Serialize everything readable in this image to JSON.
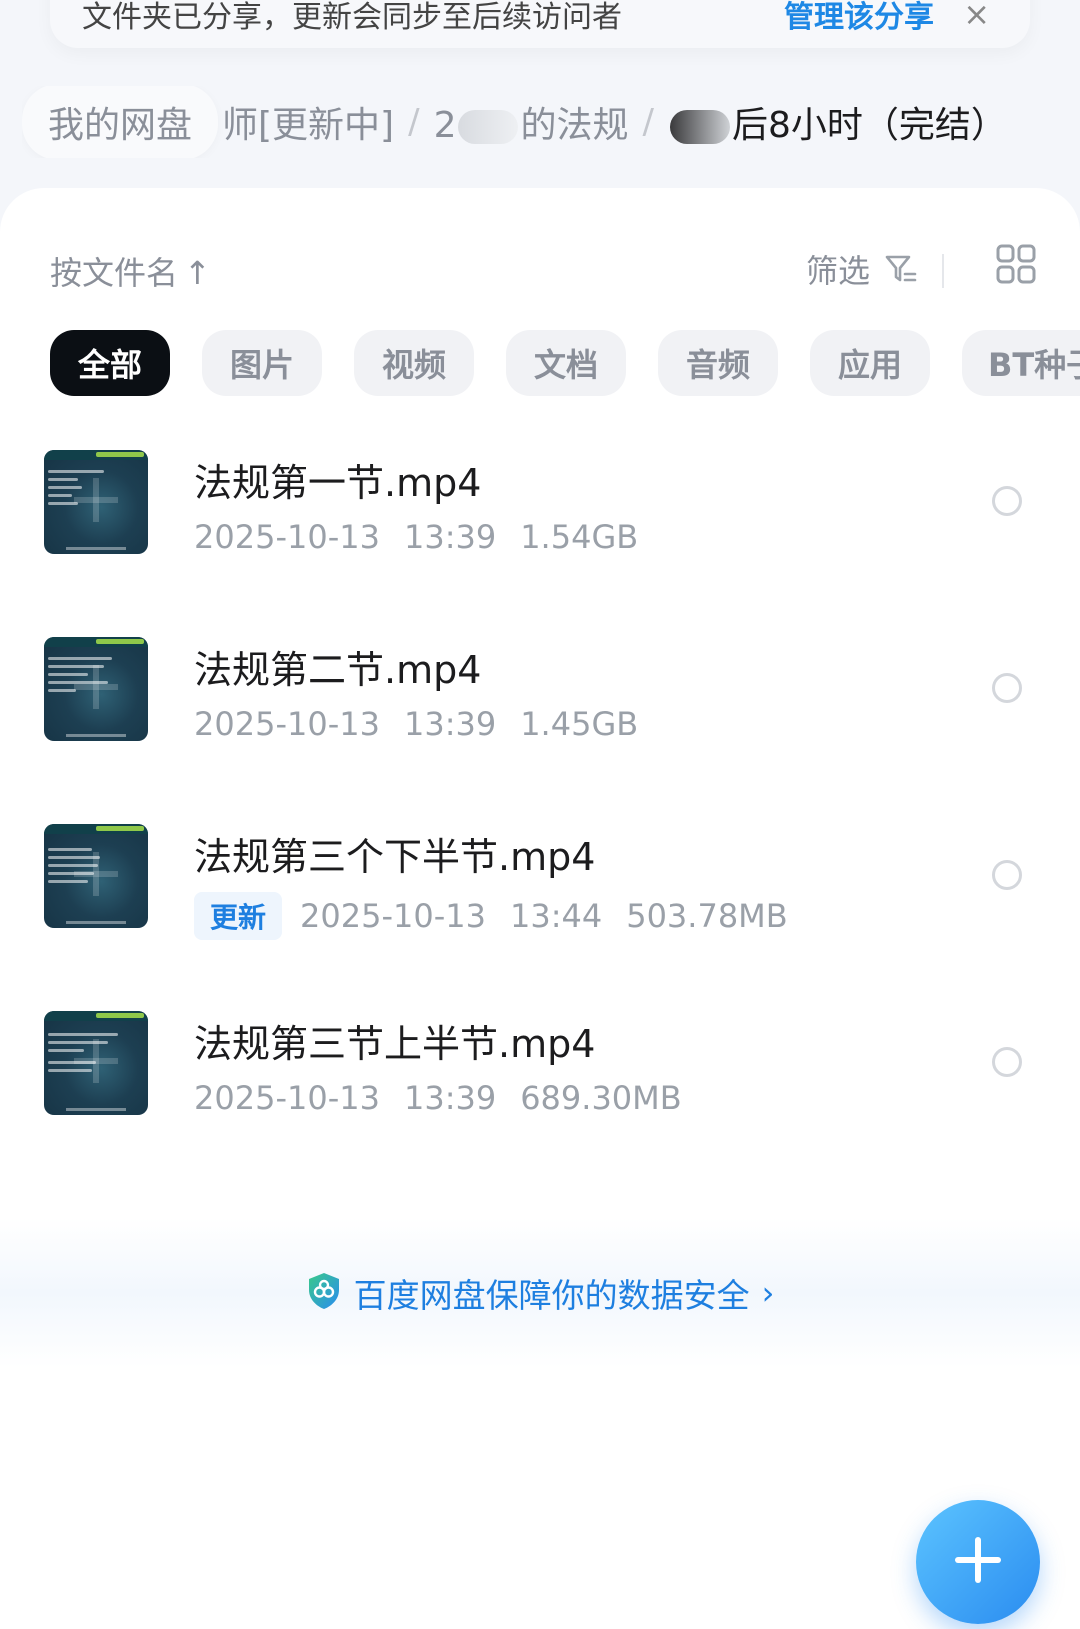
{
  "banner": {
    "text": "文件夹已分享，更新会同步至后续访问者",
    "action_label": "管理该分享",
    "close_glyph": "×"
  },
  "breadcrumb": {
    "home": "我的网盘",
    "level1": "师[更新中]",
    "level2_prefix": "2",
    "level2_suffix": "的法规",
    "current_suffix": "后8小时（完结）",
    "separator": "/"
  },
  "toolbar": {
    "sort_label": "按文件名",
    "sort_arrow": "↑",
    "filter_label": "筛选"
  },
  "tabs": [
    {
      "label": "全部",
      "active": true
    },
    {
      "label": "图片",
      "active": false
    },
    {
      "label": "视频",
      "active": false
    },
    {
      "label": "文档",
      "active": false
    },
    {
      "label": "音频",
      "active": false
    },
    {
      "label": "应用",
      "active": false
    },
    {
      "label": "BT种子",
      "active": false
    }
  ],
  "files": [
    {
      "name": "法规第一节.mp4",
      "date": "2025-10-13",
      "time": "13:39",
      "size": "1.54GB",
      "badge": ""
    },
    {
      "name": "法规第二节.mp4",
      "date": "2025-10-13",
      "time": "13:39",
      "size": "1.45GB",
      "badge": ""
    },
    {
      "name": "法规第三个下半节.mp4",
      "date": "2025-10-13",
      "time": "13:44",
      "size": "503.78MB",
      "badge": "更新"
    },
    {
      "name": "法规第三节上半节.mp4",
      "date": "2025-10-13",
      "time": "13:39",
      "size": "689.30MB",
      "badge": ""
    }
  ],
  "safety": {
    "text": "百度网盘保障你的数据安全",
    "chevron": "›"
  },
  "colors": {
    "accent": "#1e7fe0",
    "active_tab": "#0b0f14",
    "fab": "#2a8cf0"
  }
}
